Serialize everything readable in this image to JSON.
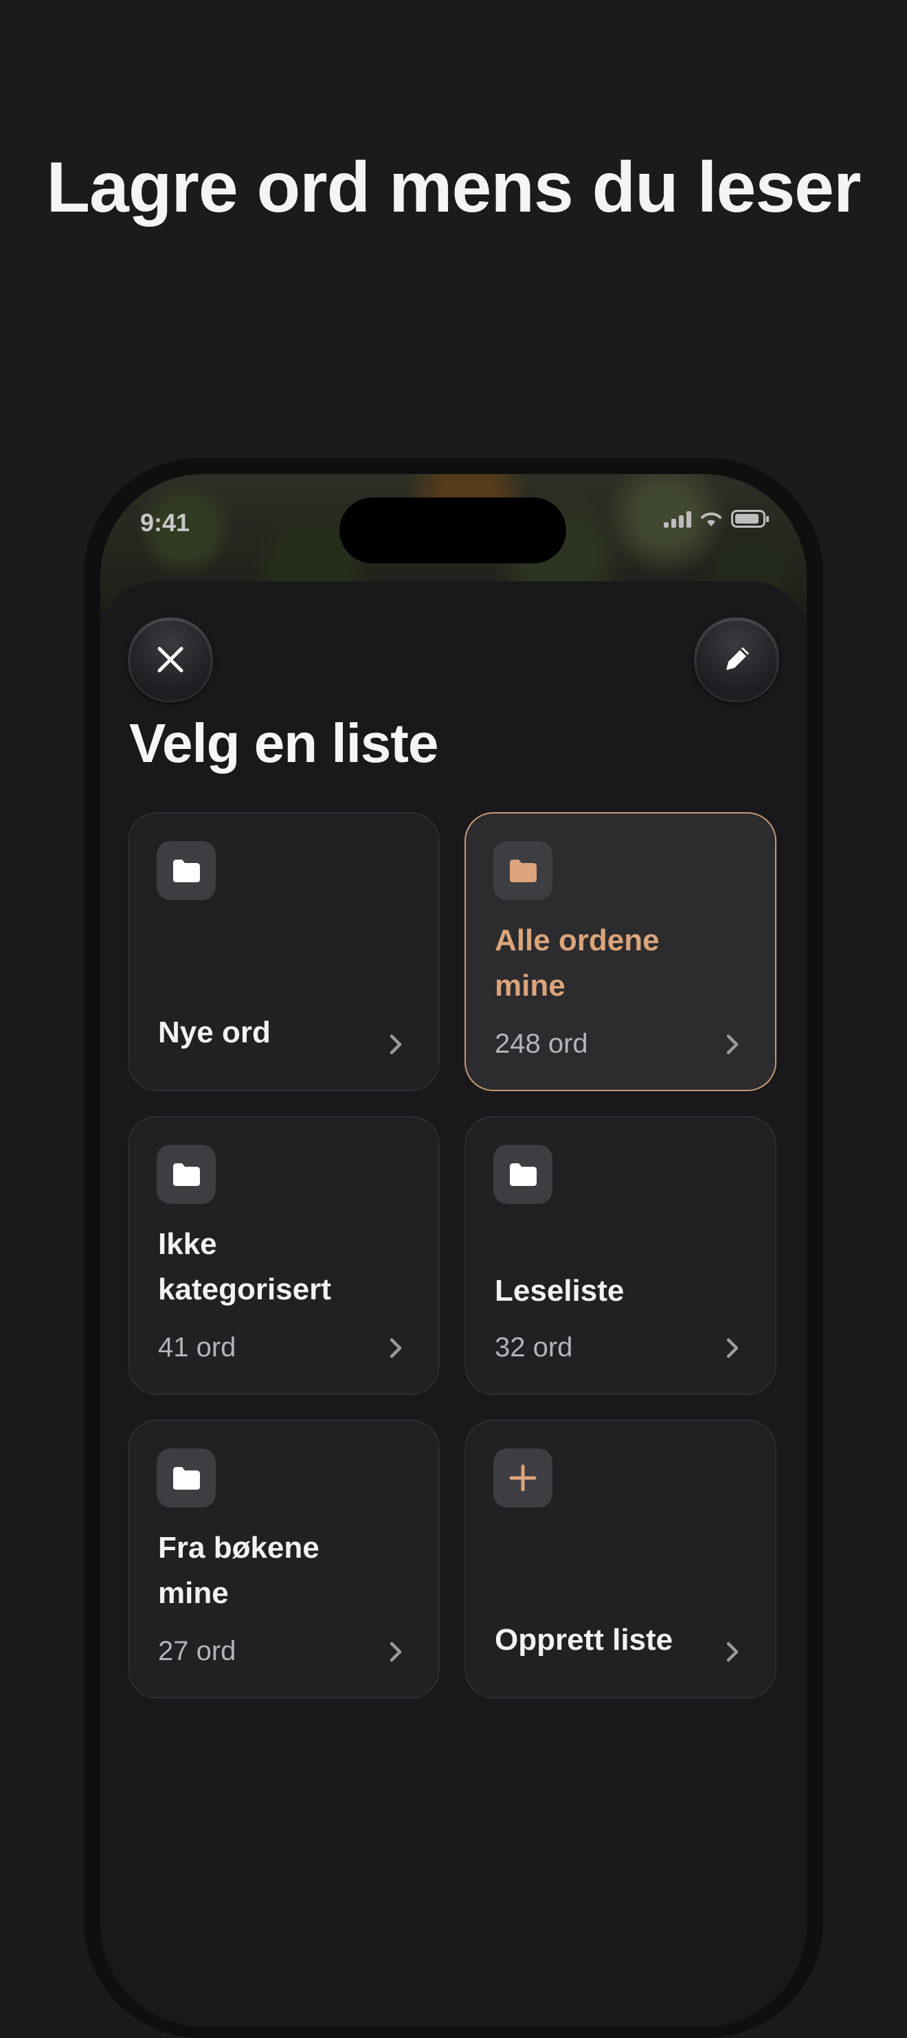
{
  "headline": "Lagre ord mens du leser",
  "status_bar": {
    "time": "9:41"
  },
  "sheet": {
    "title": "Velg en liste",
    "close_icon": "close-icon",
    "edit_icon": "pencil-icon"
  },
  "lists": [
    {
      "title": "Nye ord",
      "count": "",
      "icon": "folder-icon"
    },
    {
      "title": "Alle ordene mine",
      "count": "248 ord",
      "icon": "folder-icon",
      "selected": true
    },
    {
      "title": "Ikke kategorisert",
      "count": "41 ord",
      "icon": "folder-icon"
    },
    {
      "title": "Leseliste",
      "count": "32 ord",
      "icon": "folder-icon"
    },
    {
      "title": "Fra bøkene mine",
      "count": "27 ord",
      "icon": "folder-icon"
    },
    {
      "title": "Opprett liste",
      "count": "",
      "icon": "plus-icon"
    }
  ],
  "colors": {
    "accent": "#dca47a",
    "background": "#1b1b1d",
    "card": "#212124"
  }
}
